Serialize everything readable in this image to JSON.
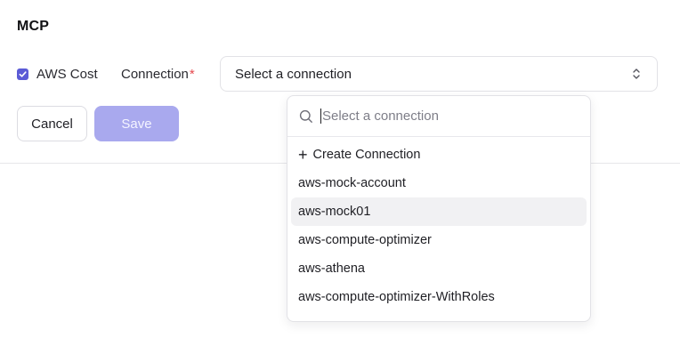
{
  "section": {
    "title": "MCP"
  },
  "integration": {
    "checkbox_checked": true,
    "checkbox_label": "AWS Cost"
  },
  "connection": {
    "label": "Connection",
    "required_marker": "*",
    "selected_text": "Select a connection"
  },
  "actions": {
    "cancel_label": "Cancel",
    "save_label": "Save"
  },
  "dropdown": {
    "search_placeholder": "Select a connection",
    "create_label": "Create Connection",
    "highlighted_index": 1,
    "options": [
      "aws-mock-account",
      "aws-mock01",
      "aws-compute-optimizer",
      "aws-athena",
      "aws-compute-optimizer-WithRoles"
    ]
  },
  "colors": {
    "accent": "#5b5bd6",
    "save_disabled_bg": "#a9a9ee",
    "required": "#e5484d",
    "highlight_bg": "#f1f1f3"
  }
}
